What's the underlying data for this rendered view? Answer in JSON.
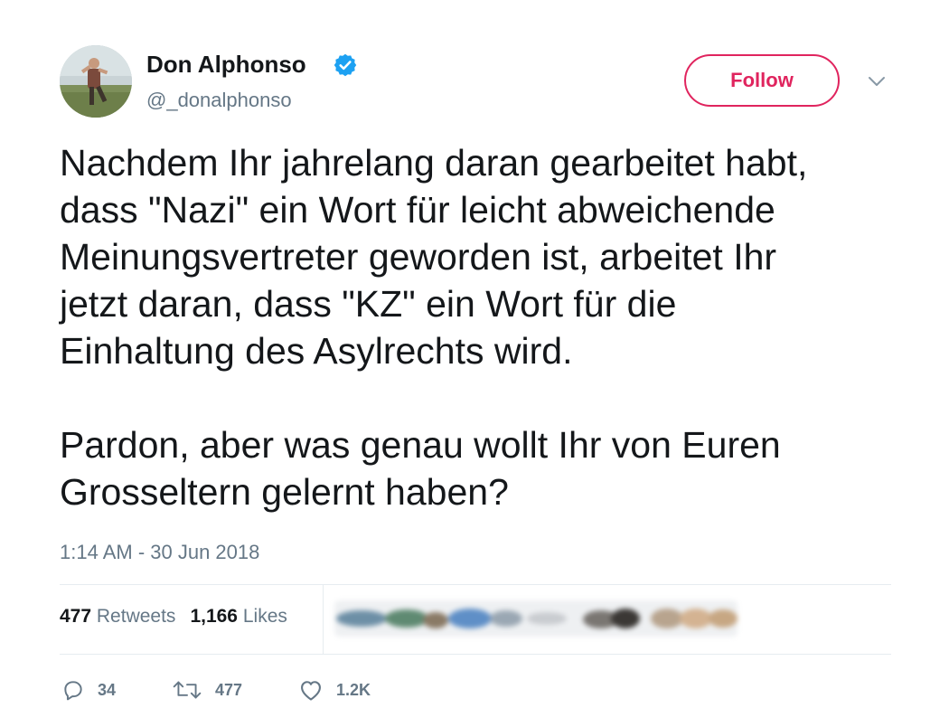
{
  "user": {
    "display_name": "Don Alphonso",
    "handle": "@_donalphonso",
    "verified": true,
    "avatar_icon": "profile-photo"
  },
  "follow_button": {
    "label": "Follow",
    "color": "#e0245e"
  },
  "more_menu": {
    "icon": "chevron-down-icon"
  },
  "tweet": {
    "paragraphs": [
      "Nachdem Ihr jahrelang daran gearbeitet habt,\ndass \"Nazi\" ein Wort für leicht abweichende\nMeinungsvertreter geworden ist, arbeitet Ihr\njetzt daran, dass \"KZ\" ein Wort für die\nEinhaltung des Asylrechts wird.",
      "Pardon, aber was genau wollt Ihr von Euren\nGrosseltern gelernt haben?"
    ],
    "timestamp": "1:14 AM - 30 Jun 2018"
  },
  "stats": {
    "retweets_count": "477",
    "retweets_label": "Retweets",
    "likes_count": "1,166",
    "likes_label": "Likes"
  },
  "actions": {
    "reply_count": "34",
    "retweet_count": "477",
    "like_count": "1.2K"
  },
  "colors": {
    "text": "#14171a",
    "secondary": "#657786",
    "verified": "#1da1f2",
    "divider": "#e6ecf0"
  }
}
